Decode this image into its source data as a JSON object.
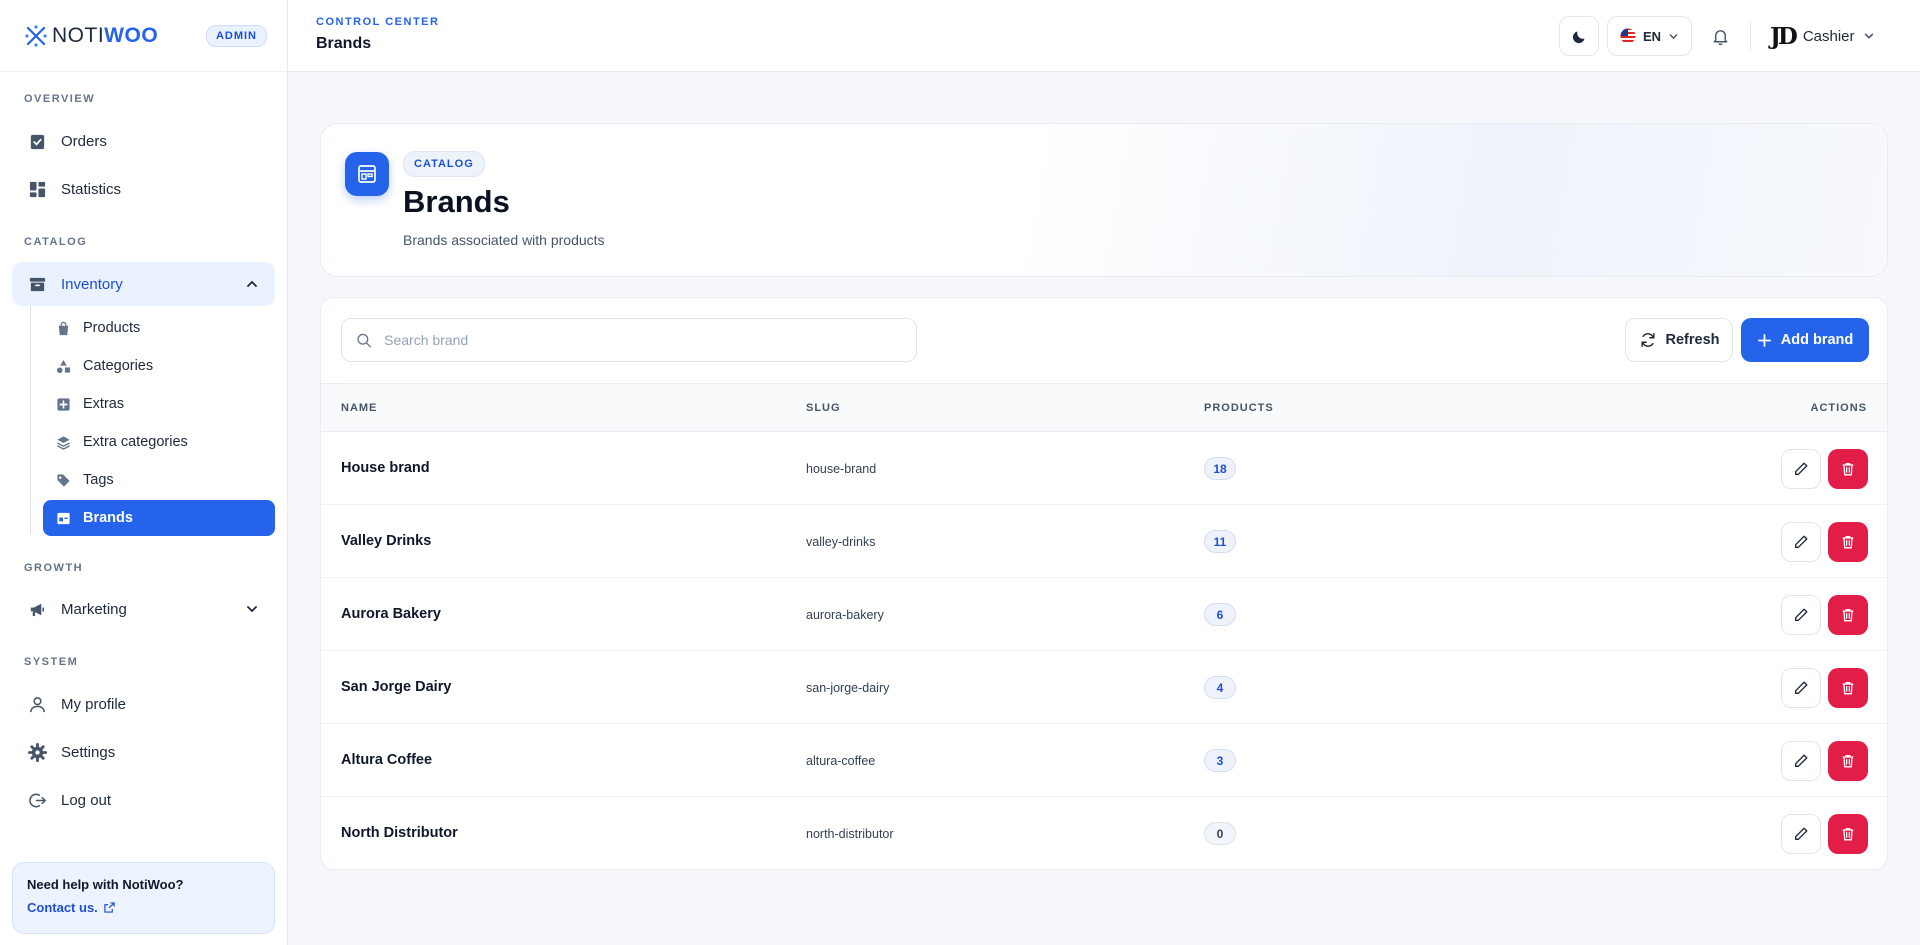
{
  "sidebar": {
    "logo_noti": "NOTI",
    "logo_woo": "WOO",
    "admin_badge": "ADMIN",
    "sections": {
      "overview": "OVERVIEW",
      "catalog": "CATALOG",
      "growth": "GROWTH",
      "system": "SYSTEM"
    },
    "items": {
      "orders": "Orders",
      "statistics": "Statistics",
      "inventory": "Inventory",
      "marketing": "Marketing",
      "my_profile": "My profile",
      "settings": "Settings",
      "log_out": "Log out"
    },
    "inventory_sub": {
      "products": "Products",
      "categories": "Categories",
      "extras": "Extras",
      "extra_categories": "Extra categories",
      "tags": "Tags",
      "brands": "Brands"
    },
    "help": {
      "title": "Need help with NotiWoo?",
      "link": "Contact us."
    }
  },
  "header": {
    "eyebrow": "CONTROL CENTER",
    "title": "Brands",
    "language": "EN",
    "user_initials": "JD",
    "user_name": "Cashier"
  },
  "hero": {
    "chip": "CATALOG",
    "title": "Brands",
    "subtitle": "Brands associated with products"
  },
  "toolbar": {
    "search_placeholder": "Search brand",
    "refresh_label": "Refresh",
    "add_label": "Add brand"
  },
  "table": {
    "columns": {
      "name": "NAME",
      "slug": "SLUG",
      "products": "PRODUCTS",
      "actions": "ACTIONS"
    },
    "rows": [
      {
        "name": "House brand",
        "slug": "house-brand",
        "products": "18"
      },
      {
        "name": "Valley Drinks",
        "slug": "valley-drinks",
        "products": "11"
      },
      {
        "name": "Aurora Bakery",
        "slug": "aurora-bakery",
        "products": "6"
      },
      {
        "name": "San Jorge Dairy",
        "slug": "san-jorge-dairy",
        "products": "4"
      },
      {
        "name": "Altura Coffee",
        "slug": "altura-coffee",
        "products": "3"
      },
      {
        "name": "North Distributor",
        "slug": "north-distributor",
        "products": "0"
      }
    ]
  },
  "colors": {
    "accent": "#2563eb",
    "danger": "#e11d48",
    "sidebar_open_bg": "#eaf1ff"
  }
}
